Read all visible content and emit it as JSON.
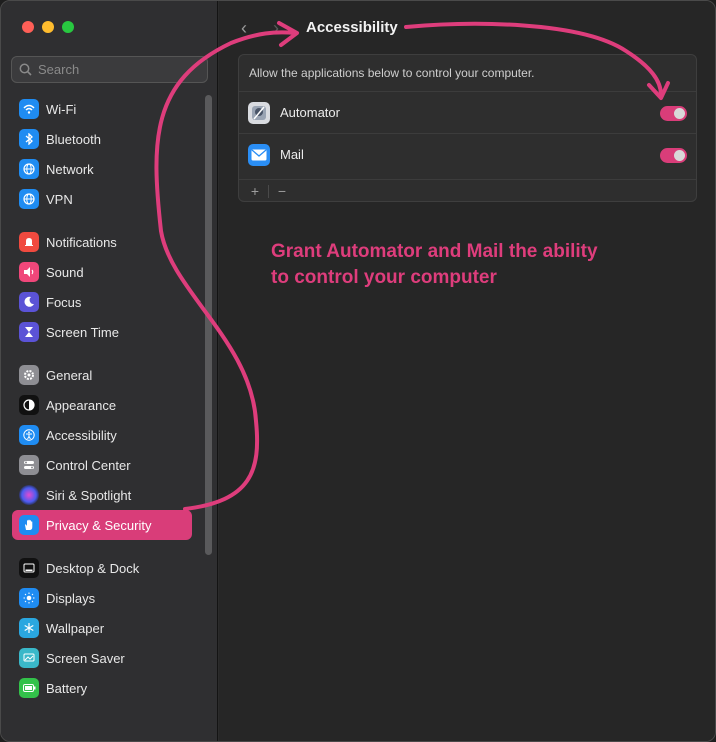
{
  "window": {
    "traffic_lights": [
      "close",
      "minimize",
      "maximize"
    ]
  },
  "search": {
    "placeholder": "Search"
  },
  "sidebar": {
    "items": [
      {
        "label": "Wi-Fi",
        "icon": "wifi-icon",
        "color": "#1f8cf2"
      },
      {
        "label": "Bluetooth",
        "icon": "bluetooth-icon",
        "color": "#1f8cf2"
      },
      {
        "label": "Network",
        "icon": "globe-icon",
        "color": "#1f8cf2"
      },
      {
        "label": "VPN",
        "icon": "vpn-globe-icon",
        "color": "#1f8cf2"
      },
      {
        "label": "Notifications",
        "icon": "bell-icon",
        "color": "#f04a3f"
      },
      {
        "label": "Sound",
        "icon": "speaker-icon",
        "color": "#f0477a"
      },
      {
        "label": "Focus",
        "icon": "moon-icon",
        "color": "#5b53d6"
      },
      {
        "label": "Screen Time",
        "icon": "hourglass-icon",
        "color": "#5b53d6"
      },
      {
        "label": "General",
        "icon": "gear-icon",
        "color": "#8e8e93"
      },
      {
        "label": "Appearance",
        "icon": "appearance-icon",
        "color": "#111111"
      },
      {
        "label": "Accessibility",
        "icon": "accessibility-icon",
        "color": "#1f8cf2"
      },
      {
        "label": "Control Center",
        "icon": "control-center-icon",
        "color": "#8e8e93"
      },
      {
        "label": "Siri & Spotlight",
        "icon": "siri-icon",
        "color": "#333333"
      },
      {
        "label": "Privacy & Security",
        "icon": "hand-icon",
        "color": "#1f8cf2",
        "selected": true
      },
      {
        "label": "Desktop & Dock",
        "icon": "dock-icon",
        "color": "#111111"
      },
      {
        "label": "Displays",
        "icon": "sun-icon",
        "color": "#1f8cf2"
      },
      {
        "label": "Wallpaper",
        "icon": "snowflake-icon",
        "color": "#2aa7e0"
      },
      {
        "label": "Screen Saver",
        "icon": "screen-saver-icon",
        "color": "#3ab8c9"
      },
      {
        "label": "Battery",
        "icon": "battery-icon",
        "color": "#33c24a"
      }
    ]
  },
  "main": {
    "title": "Accessibility",
    "description": "Allow the applications below to control your computer.",
    "apps": [
      {
        "name": "Automator",
        "icon": "automator-icon",
        "enabled": true
      },
      {
        "name": "Mail",
        "icon": "mail-icon",
        "enabled": true
      }
    ],
    "add_label": "+",
    "remove_label": "−"
  },
  "annotation": {
    "line1": "Grant Automator and Mail the ability",
    "line2": "to control your computer",
    "color": "#de3d7c"
  },
  "colors": {
    "accent": "#d93d79"
  }
}
